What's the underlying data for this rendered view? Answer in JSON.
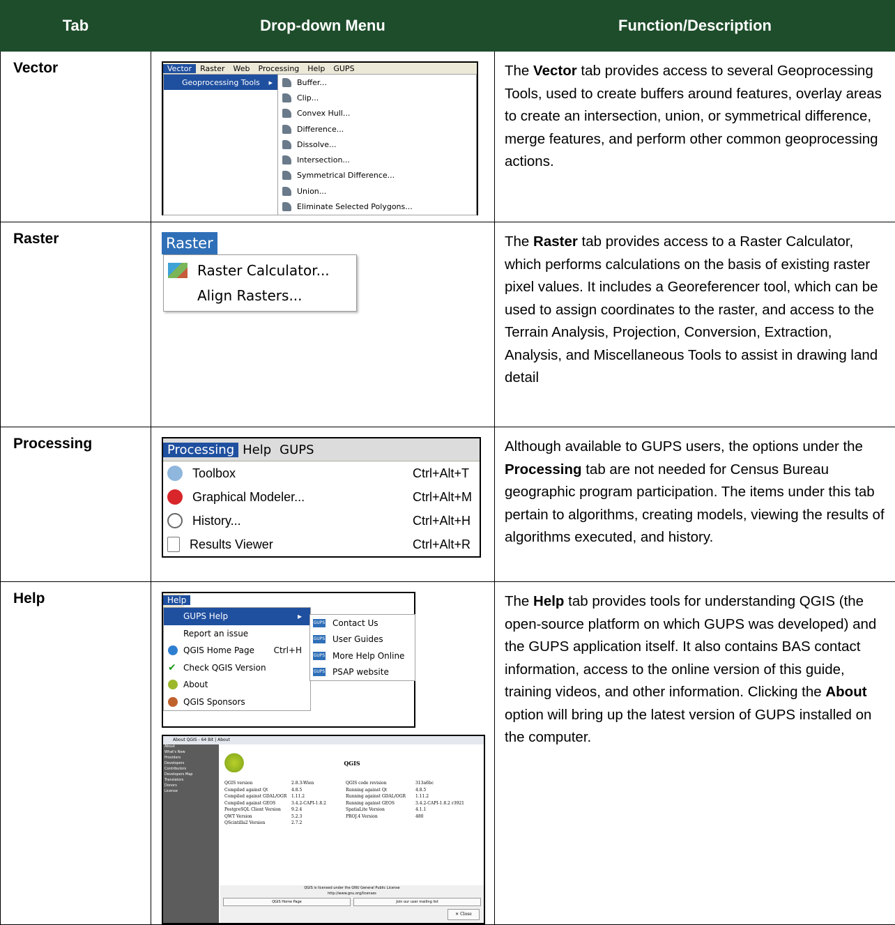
{
  "headers": [
    "Tab",
    "Drop-down Menu",
    "Function/Description"
  ],
  "colors": {
    "header_bg": "#1e4d2b",
    "menu_highlight": "#1f4f9f"
  },
  "rows": [
    {
      "tab": "Vector",
      "menu": {
        "menubar": [
          "Vector",
          "Raster",
          "Web",
          "Processing",
          "Help",
          "GUPS"
        ],
        "selected_item": "Geoprocessing Tools",
        "submenu": [
          "Buffer...",
          "Clip...",
          "Convex Hull...",
          "Difference...",
          "Dissolve...",
          "Intersection...",
          "Symmetrical Difference...",
          "Union...",
          "Eliminate Selected Polygons..."
        ]
      },
      "desc": {
        "a": "The ",
        "b": "Vector",
        "c": " tab provides access to several Geoprocessing Tools, used to create buffers around features, overlay areas to create an intersection, union, or symmetrical difference, merge features, and perform other common geoprocessing actions."
      }
    },
    {
      "tab": "Raster",
      "menu": {
        "header": "Raster",
        "items": [
          "Raster Calculator...",
          "Align Rasters..."
        ]
      },
      "desc": {
        "a": "The ",
        "b": "Raster",
        "c": " tab provides access to a Raster Calculator, which performs calculations on the basis of existing raster pixel values. It includes a Georeferencer tool, which can be used to assign coordinates to the raster, and access to the Terrain Analysis, Projection, Conversion, Extraction, Analysis, and Miscellaneous Tools to assist in drawing land detail"
      }
    },
    {
      "tab": "Processing",
      "menu": {
        "menubar": [
          "Processing",
          "Help",
          "GUPS"
        ],
        "items": [
          {
            "label": "Toolbox",
            "shortcut": "Ctrl+Alt+T",
            "icon": "gear-icon"
          },
          {
            "label": "Graphical Modeler...",
            "shortcut": "Ctrl+Alt+M",
            "icon": "gears-icon"
          },
          {
            "label": "History...",
            "shortcut": "Ctrl+Alt+H",
            "icon": "clock-icon"
          },
          {
            "label": "Results Viewer",
            "shortcut": "Ctrl+Alt+R",
            "icon": "document-icon"
          }
        ]
      },
      "desc": {
        "a": "Although available to GUPS users, the options under the ",
        "b": "Processing",
        "c": " tab are not needed for Census Bureau geographic program participation. The items under this tab pertain to algorithms, creating models, viewing the results of algorithms executed, and history."
      }
    },
    {
      "tab": "Help",
      "menu": {
        "header": "Help",
        "items": [
          {
            "label": "GUPS Help",
            "shortcut": ""
          },
          {
            "label": "Report an issue",
            "shortcut": ""
          },
          {
            "label": "QGIS Home Page",
            "shortcut": "Ctrl+H"
          },
          {
            "label": "Check QGIS Version",
            "shortcut": ""
          },
          {
            "label": "About",
            "shortcut": ""
          },
          {
            "label": "QGIS Sponsors",
            "shortcut": ""
          }
        ],
        "submenu": [
          "Contact Us",
          "User Guides",
          "More Help Online",
          "PSAP website"
        ],
        "icon_text": "GUPS",
        "about": {
          "window_title": "About QGIS - 64 Bit | About",
          "sidebar": [
            "About",
            "What's New",
            "Providers",
            "Developers",
            "Contributors",
            "Developers Map",
            "Translators",
            "Donors",
            "License"
          ],
          "title": "QGIS",
          "rows": [
            [
              "QGIS version",
              "2.8.3-Wien",
              "QGIS code revision",
              "313a6bc"
            ],
            [
              "Compiled against Qt",
              "4.8.5",
              "Running against Qt",
              "4.8.5"
            ],
            [
              "Compiled against GDAL/OGR",
              "1.11.2",
              "Running against GDAL/OGR",
              "1.11.2"
            ],
            [
              "Compiled against GEOS",
              "3.4.2-CAPI-1.8.2",
              "Running against GEOS",
              "3.4.2-CAPI-1.8.2 r3921"
            ],
            [
              "PostgreSQL Client Version",
              "9.2.4",
              "SpatiaLite Version",
              "4.1.1"
            ],
            [
              "QWT Version",
              "5.2.3",
              "PROJ.4 Version",
              "480"
            ],
            [
              "QScintilla2 Version",
              "2.7.2",
              "",
              ""
            ]
          ],
          "license_line": "QGIS is licensed under the GNU General Public License",
          "license_url": "http://www.gnu.org/licenses",
          "btn_home": "QGIS Home Page",
          "btn_mail": "Join our user mailing list",
          "btn_close": "Close"
        }
      },
      "desc": {
        "a": "The ",
        "b": "Help",
        "c": " tab provides tools for understanding QGIS (the open-source platform on which GUPS was developed) and the GUPS application itself. It also contains BAS contact information, access to the online version of this guide, training videos, and other information. Clicking the ",
        "d": "About",
        "e": " option will bring up the latest version of GUPS installed on the computer."
      }
    }
  ]
}
